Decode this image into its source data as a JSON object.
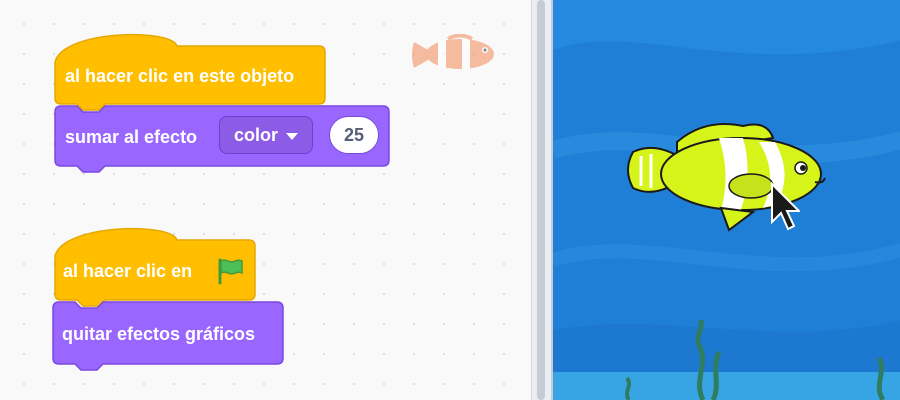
{
  "script1": {
    "hat_label": "al hacer clic en este objeto",
    "command_label": "sumar al efecto",
    "effect_dropdown": "color",
    "amount_value": "25"
  },
  "script2": {
    "hat_label": "al hacer clic en",
    "command_label": "quitar efectos gráficos"
  },
  "colors": {
    "events": "#ffbf00",
    "looks": "#9966ff",
    "stage_water": "#1a8ae0"
  },
  "icons": [
    "green-flag-icon",
    "clownfish-sprite-thumbnail",
    "mouse-pointer-icon",
    "clownfish-sprite"
  ]
}
